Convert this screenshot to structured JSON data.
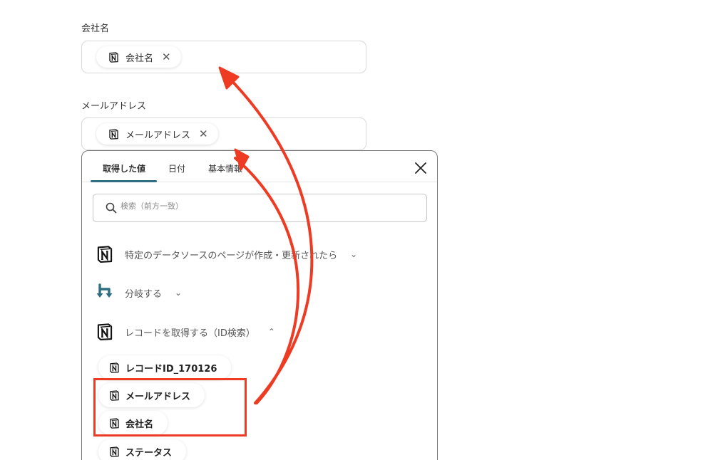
{
  "fields": [
    {
      "label": "会社名",
      "chip": "会社名"
    },
    {
      "label": "メールアドレス",
      "chip": "メールアドレス"
    }
  ],
  "panel": {
    "tabs": [
      "取得した値",
      "日付",
      "基本情報"
    ],
    "active_tab": "取得した値",
    "search_placeholder": "検索（前方一致）",
    "sections": [
      {
        "label": "特定のデータソースのページが作成・更新されたら",
        "icon": "notion-icon",
        "state": "collapsed"
      },
      {
        "label": "分岐する",
        "icon": "branch-icon",
        "state": "collapsed"
      },
      {
        "label": "レコードを取得する（ID検索）",
        "icon": "notion-icon",
        "state": "expanded"
      }
    ],
    "items": [
      "レコードID_170126",
      "メールアドレス",
      "会社名",
      "ステータス"
    ]
  },
  "colors": {
    "accent": "#2f6e83",
    "annotation": "#ee3b24",
    "border": "#d9d9d9"
  }
}
